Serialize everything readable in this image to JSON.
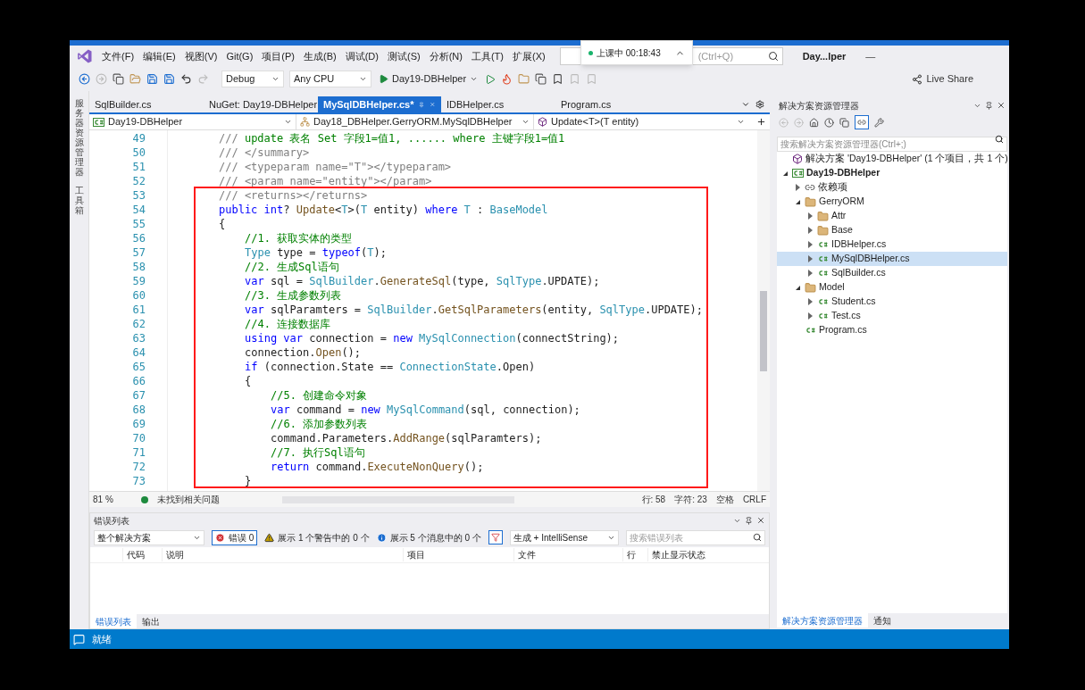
{
  "menu_bar": {
    "items": [
      "文件(F)",
      "编辑(E)",
      "视图(V)",
      "Git(G)",
      "项目(P)",
      "生成(B)",
      "调试(D)",
      "测试(S)",
      "分析(N)",
      "工具(T)",
      "扩展(X)"
    ],
    "search": {
      "placeholder": "(Ctrl+Q)"
    },
    "title": "Day...lper",
    "minimize": "—"
  },
  "recording_badge": {
    "text": "上课中 00:18:43"
  },
  "toolbar": {
    "configuration": "Debug",
    "platform": "Any CPU",
    "start_target": "Day19-DBHelper",
    "live_share": "Live Share"
  },
  "side_strip": [
    "服务器资源管理器",
    "工具箱"
  ],
  "editor": {
    "tabs": [
      {
        "label": "SqlBuilder.cs",
        "selected": false
      },
      {
        "label": "NuGet: Day19-DBHelper",
        "selected": false
      },
      {
        "label": "MySqlDBHelper.cs*",
        "selected": true
      },
      {
        "label": "IDBHelper.cs",
        "selected": false
      },
      {
        "label": "Program.cs",
        "selected": false
      }
    ],
    "nav": [
      "Day19-DBHelper",
      "Day18_DBHelper.GerryORM.MySqlDBHelper",
      "Update<T>(T entity)"
    ],
    "lines": [
      {
        "number": "49",
        "kind": "member",
        "tokens": [
          {
            "text": "///",
            "kind": "doc"
          },
          {
            "text": " update 表名 Set 字段1=值1, ...... where 主键字段1=值1",
            "kind": "comment"
          }
        ]
      },
      {
        "number": "50",
        "kind": "member",
        "tokens": [
          {
            "text": "/// </summary>",
            "kind": "doc"
          }
        ]
      },
      {
        "number": "51",
        "kind": "member",
        "tokens": [
          {
            "text": "/// <typeparam name=\"T\"></typeparam>",
            "kind": "doc"
          }
        ]
      },
      {
        "number": "52",
        "kind": "member",
        "tokens": [
          {
            "text": "/// <param name=\"entity\"></param>",
            "kind": "doc"
          }
        ]
      },
      {
        "number": "53",
        "kind": "member",
        "tokens": [
          {
            "text": "/// <returns></returns>",
            "kind": "doc"
          }
        ]
      },
      {
        "number": "54",
        "kind": "member",
        "tokens": [
          {
            "text": "public int",
            "kind": "keyword"
          },
          {
            "text": "? ",
            "kind": "plain"
          },
          {
            "text": "Update",
            "kind": "method"
          },
          {
            "text": "<",
            "kind": "plain"
          },
          {
            "text": "T",
            "kind": "type"
          },
          {
            "text": ">(",
            "kind": "plain"
          },
          {
            "text": "T",
            "kind": "type"
          },
          {
            "text": " entity) ",
            "kind": "plain"
          },
          {
            "text": "where",
            "kind": "keyword"
          },
          {
            "text": " T",
            "kind": "type"
          },
          {
            "text": " : ",
            "kind": "plain"
          },
          {
            "text": "BaseModel",
            "kind": "type"
          }
        ]
      },
      {
        "number": "55",
        "kind": "member",
        "tokens": [
          {
            "text": "{",
            "kind": "plain"
          }
        ]
      },
      {
        "number": "56",
        "kind": "body",
        "tokens": [
          {
            "text": "//1. 获取实体的类型",
            "kind": "comment"
          }
        ]
      },
      {
        "number": "57",
        "kind": "body",
        "tokens": [
          {
            "text": "Type",
            "kind": "type"
          },
          {
            "text": " type = ",
            "kind": "plain"
          },
          {
            "text": "typeof",
            "kind": "keyword"
          },
          {
            "text": "(",
            "kind": "plain"
          },
          {
            "text": "T",
            "kind": "type"
          },
          {
            "text": ");",
            "kind": "plain"
          }
        ]
      },
      {
        "number": "58",
        "kind": "body",
        "tokens": [
          {
            "text": "//2. 生成Sql语句",
            "kind": "comment"
          }
        ]
      },
      {
        "number": "59",
        "kind": "body",
        "tokens": [
          {
            "text": "var",
            "kind": "keyword"
          },
          {
            "text": " sql = ",
            "kind": "plain"
          },
          {
            "text": "SqlBuilder",
            "kind": "type"
          },
          {
            "text": ".",
            "kind": "plain"
          },
          {
            "text": "GenerateSql",
            "kind": "method"
          },
          {
            "text": "(type, ",
            "kind": "plain"
          },
          {
            "text": "SqlType",
            "kind": "type"
          },
          {
            "text": ".UPDATE);",
            "kind": "plain"
          }
        ]
      },
      {
        "number": "60",
        "kind": "body",
        "tokens": [
          {
            "text": "//3. 生成参数列表",
            "kind": "comment"
          }
        ]
      },
      {
        "number": "61",
        "kind": "body",
        "tokens": [
          {
            "text": "var",
            "kind": "keyword"
          },
          {
            "text": " sqlParamters = ",
            "kind": "plain"
          },
          {
            "text": "SqlBuilder",
            "kind": "type"
          },
          {
            "text": ".",
            "kind": "plain"
          },
          {
            "text": "GetSqlParameters",
            "kind": "method"
          },
          {
            "text": "(entity, ",
            "kind": "plain"
          },
          {
            "text": "SqlType",
            "kind": "type"
          },
          {
            "text": ".UPDATE);",
            "kind": "plain"
          }
        ]
      },
      {
        "number": "62",
        "kind": "body",
        "tokens": [
          {
            "text": "//4. 连接数据库",
            "kind": "comment"
          }
        ]
      },
      {
        "number": "63",
        "kind": "body",
        "tokens": [
          {
            "text": "using var",
            "kind": "keyword"
          },
          {
            "text": " connection = ",
            "kind": "plain"
          },
          {
            "text": "new",
            "kind": "keyword"
          },
          {
            "text": " MySqlConnection",
            "kind": "type"
          },
          {
            "text": "(connectString);",
            "kind": "plain"
          }
        ]
      },
      {
        "number": "64",
        "kind": "body",
        "tokens": [
          {
            "text": "connection.",
            "kind": "plain"
          },
          {
            "text": "Open",
            "kind": "method"
          },
          {
            "text": "();",
            "kind": "plain"
          }
        ]
      },
      {
        "number": "65",
        "kind": "body",
        "tokens": [
          {
            "text": "if",
            "kind": "keyword"
          },
          {
            "text": " (connection.State == ",
            "kind": "plain"
          },
          {
            "text": "ConnectionState",
            "kind": "type"
          },
          {
            "text": ".Open)",
            "kind": "plain"
          }
        ]
      },
      {
        "number": "66",
        "kind": "body",
        "tokens": [
          {
            "text": "{",
            "kind": "plain"
          }
        ]
      },
      {
        "number": "67",
        "kind": "nested",
        "tokens": [
          {
            "text": "//5. 创建命令对象",
            "kind": "comment"
          }
        ]
      },
      {
        "number": "68",
        "kind": "nested",
        "tokens": [
          {
            "text": "var",
            "kind": "keyword"
          },
          {
            "text": " command = ",
            "kind": "plain"
          },
          {
            "text": "new",
            "kind": "keyword"
          },
          {
            "text": " MySqlCommand",
            "kind": "type"
          },
          {
            "text": "(sql, connection);",
            "kind": "plain"
          }
        ]
      },
      {
        "number": "69",
        "kind": "nested",
        "tokens": [
          {
            "text": "//6. 添加参数列表",
            "kind": "comment"
          }
        ]
      },
      {
        "number": "70",
        "kind": "nested",
        "tokens": [
          {
            "text": "command.Parameters.",
            "kind": "plain"
          },
          {
            "text": "AddRange",
            "kind": "method"
          },
          {
            "text": "(sqlParamters);",
            "kind": "plain"
          }
        ]
      },
      {
        "number": "71",
        "kind": "nested",
        "tokens": [
          {
            "text": "//7. 执行Sql语句",
            "kind": "comment"
          }
        ]
      },
      {
        "number": "72",
        "kind": "nested",
        "tokens": [
          {
            "text": "return",
            "kind": "keyword"
          },
          {
            "text": " command.",
            "kind": "plain"
          },
          {
            "text": "ExecuteNonQuery",
            "kind": "method"
          },
          {
            "text": "();",
            "kind": "plain"
          }
        ]
      },
      {
        "number": "73",
        "kind": "body",
        "tokens": [
          {
            "text": "}",
            "kind": "plain"
          }
        ]
      }
    ],
    "status": {
      "zoom": "81 %",
      "issues": "未找到相关问题",
      "line": "行: 58",
      "char": "字符: 23",
      "spacing": "空格",
      "eol": "CRLF"
    }
  },
  "error_list": {
    "title": "错误列表",
    "scope": "整个解决方案",
    "errors": "错误 0",
    "warnings": "展示 1 个警告中的 0 个",
    "messages": "展示 5 个消息中的 0 个",
    "source": "生成 + IntelliSense",
    "search": {
      "placeholder": "搜索错误列表"
    },
    "columns": [
      "代码",
      "说明",
      "项目",
      "文件",
      "行",
      "禁止显示状态"
    ],
    "tabs": [
      {
        "label": "错误列表",
        "selected": true
      },
      {
        "label": "输出",
        "selected": false
      }
    ]
  },
  "solution_explorer": {
    "title": "解决方案资源管理器",
    "search": {
      "placeholder": "搜索解决方案资源管理器(Ctrl+;)"
    },
    "tree": [
      {
        "label": "解决方案 'Day19-DBHelper' (1 个项目，共 1 个)",
        "kind": "solution",
        "selected": false,
        "children": [
          {
            "label": "Day19-DBHelper",
            "kind": "project",
            "expanded": true,
            "selected": false,
            "children": [
              {
                "label": "依赖项",
                "kind": "dependencies",
                "expanded": false,
                "selected": false
              },
              {
                "label": "GerryORM",
                "kind": "folder",
                "expanded": true,
                "selected": false,
                "children": [
                  {
                    "label": "Attr",
                    "kind": "folder",
                    "expanded": false,
                    "selected": false
                  },
                  {
                    "label": "Base",
                    "kind": "folder",
                    "expanded": false,
                    "selected": false
                  },
                  {
                    "label": "IDBHelper.cs",
                    "kind": "cs",
                    "expanded": false,
                    "selected": false
                  },
                  {
                    "label": "MySqlDBHelper.cs",
                    "kind": "cs",
                    "expanded": false,
                    "selected": true
                  },
                  {
                    "label": "SqlBuilder.cs",
                    "kind": "cs",
                    "expanded": false,
                    "selected": false
                  }
                ]
              },
              {
                "label": "Model",
                "kind": "folder",
                "expanded": true,
                "selected": false,
                "children": [
                  {
                    "label": "Student.cs",
                    "kind": "cs",
                    "expanded": false,
                    "selected": false
                  },
                  {
                    "label": "Test.cs",
                    "kind": "cs",
                    "expanded": false,
                    "selected": false
                  }
                ]
              },
              {
                "label": "Program.cs",
                "kind": "cs",
                "selected": false
              }
            ]
          }
        ]
      }
    ],
    "tabs": [
      {
        "label": "解决方案资源管理器",
        "selected": true
      },
      {
        "label": "通知",
        "selected": false
      }
    ]
  },
  "status_bar": {
    "text": "就绪"
  }
}
